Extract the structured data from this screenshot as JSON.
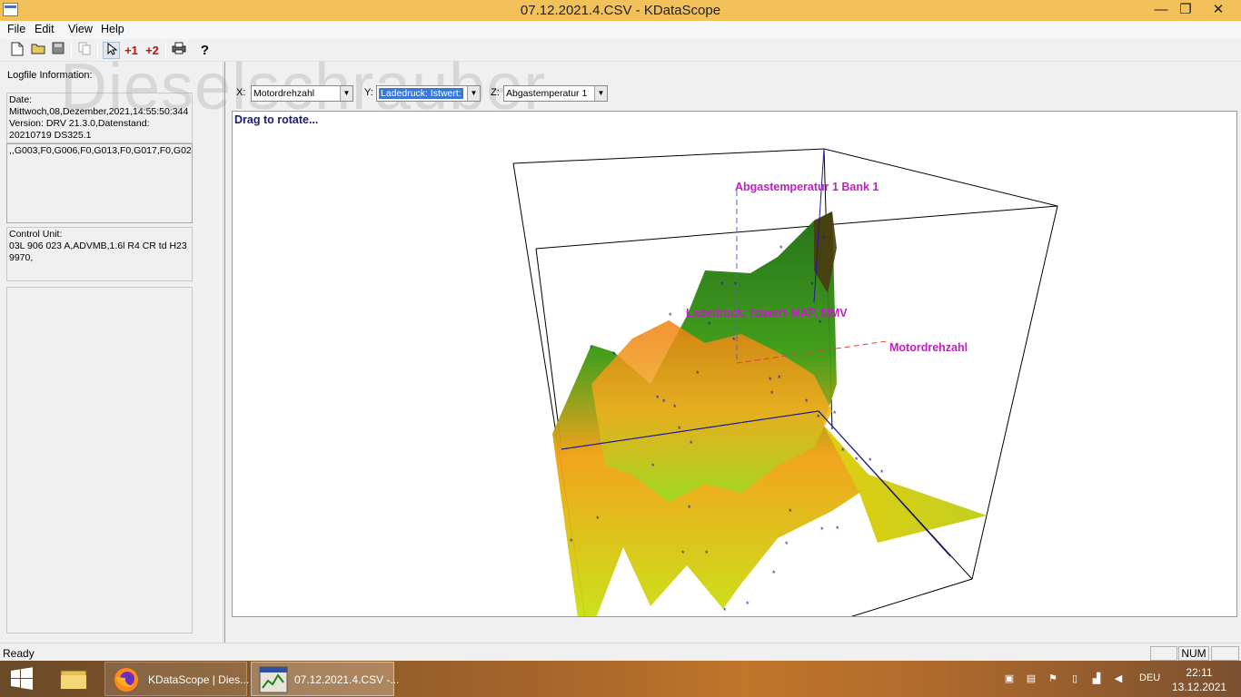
{
  "window": {
    "title": "07.12.2021.4.CSV - KDataScope",
    "controls": {
      "minimize": "—",
      "restore": "❐",
      "close": "✕"
    }
  },
  "menu": [
    "File",
    "Edit",
    "View",
    "Help"
  ],
  "toolbar": {
    "plus1": "+1",
    "plus2": "+2",
    "help": "?"
  },
  "watermark": "Dieselschrauber",
  "left_panel": {
    "title": "Logfile Information:",
    "date_info": "Date:\nMittwoch,08,Dezember,2021,14:55:50:344\nVersion: DRV 21.3.0,Datenstand:\n20210719 DS325.1",
    "groups": ",,G003,F0,G006,F0,G013,F0,G017,F0,G02",
    "control_unit": "Control Unit:\n03L 906 023 A,ADVMB,1.6l R4 CR td H23\n9970,",
    "empty": ""
  },
  "axes": {
    "x_label": "X:",
    "x_value": "Motordrehzahl",
    "y_label": "Y:",
    "y_value": "Ladedruck: Istwert: ",
    "z_label": "Z:",
    "z_value": "Abgastemperatur 1 "
  },
  "plot": {
    "hint": "Drag to rotate...",
    "z_axis_label": "Abgastemperatur 1 Bank 1",
    "y_axis_label": "Ladedruck: Istwert-MAP, MMV",
    "x_axis_label": "Motordrehzahl",
    "label_color": "#c020c0"
  },
  "status": {
    "text": "Ready",
    "num": "NUM"
  },
  "taskbar": {
    "firefox_label": "KDataScope | Dies...",
    "app_label": "07.12.2021.4.CSV -...",
    "lang": "DEU",
    "time": "22:11",
    "date": "13.12.2021"
  }
}
